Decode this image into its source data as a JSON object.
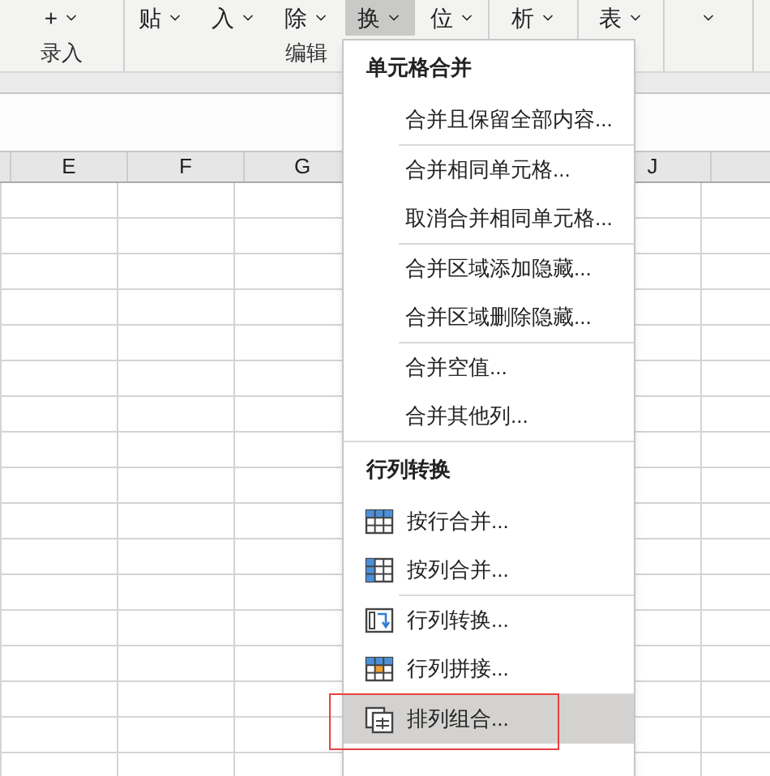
{
  "ribbon": {
    "groups": [
      {
        "label": "录入",
        "buttons": [
          {
            "label": "+",
            "selected": false
          }
        ]
      },
      {
        "label": "编辑",
        "buttons": [
          {
            "label": "贴",
            "selected": false
          },
          {
            "label": "入",
            "selected": false
          },
          {
            "label": "除",
            "selected": false
          },
          {
            "label": "换",
            "selected": true
          },
          {
            "label": "位",
            "selected": false
          }
        ]
      },
      {
        "buttons": [
          {
            "label": "析",
            "selected": false
          }
        ]
      },
      {
        "buttons": [
          {
            "label": "表",
            "selected": false
          }
        ]
      },
      {
        "buttons": [
          {
            "selected": false
          }
        ]
      }
    ]
  },
  "sheet": {
    "columns": [
      "E",
      "F",
      "G",
      "J"
    ]
  },
  "menu": {
    "sections": [
      {
        "title": "单元格合并",
        "groups": [
          [
            {
              "label": "合并且保留全部内容...",
              "selected": false
            }
          ],
          [
            {
              "label": "合并相同单元格...",
              "selected": false
            },
            {
              "label": "取消合并相同单元格...",
              "selected": false
            }
          ],
          [
            {
              "label": "合并区域添加隐藏...",
              "selected": false
            },
            {
              "label": "合并区域删除隐藏...",
              "selected": false
            }
          ],
          [
            {
              "label": "合并空值...",
              "selected": false
            },
            {
              "label": "合并其他列...",
              "selected": false
            }
          ]
        ]
      },
      {
        "title": "行列转换",
        "groups": [
          [
            {
              "label": "按行合并...",
              "kind": "rows",
              "selected": false
            },
            {
              "label": "按列合并...",
              "kind": "columns",
              "selected": false
            }
          ],
          [
            {
              "label": "行列转换...",
              "kind": "transpose",
              "selected": false
            },
            {
              "label": "行列拼接...",
              "kind": "join",
              "selected": false
            }
          ],
          [
            {
              "label": "排列组合...",
              "kind": "combine",
              "selected": true
            }
          ]
        ]
      }
    ]
  }
}
